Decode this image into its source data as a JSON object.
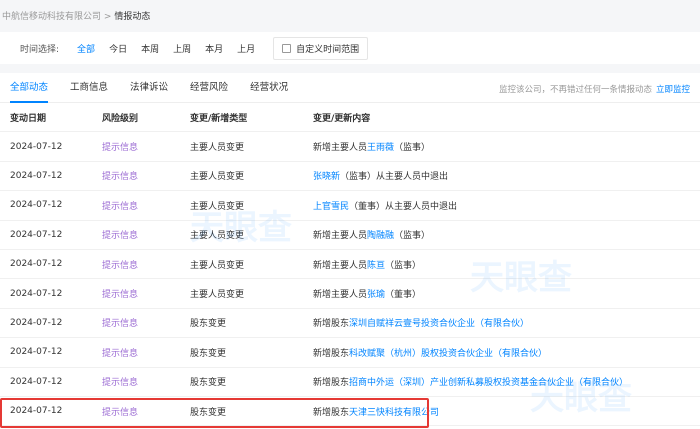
{
  "breadcrumb": {
    "company": "中航信移动科技有限公司",
    "sep": ">",
    "current": "情报动态"
  },
  "filter": {
    "label": "时间选择:",
    "options": [
      "全部",
      "今日",
      "本周",
      "上周",
      "本月",
      "上月"
    ],
    "custom": "自定义时间范围"
  },
  "tabs": [
    "全部动态",
    "工商信息",
    "法律诉讼",
    "经营风险",
    "经营状况"
  ],
  "monitor": {
    "text": "监控该公司，不再错过任何一条情报动态",
    "link": "立即监控"
  },
  "watermark": "天眼查",
  "columns": [
    "变动日期",
    "风险级别",
    "变更/新增类型",
    "变更/更新内容"
  ],
  "rows": [
    {
      "date": "2024-07-12",
      "risk": "提示信息",
      "type": "主要人员变更",
      "pre": "新增主要人员",
      "link": "王雨薇",
      "post": "（监事）"
    },
    {
      "date": "2024-07-12",
      "risk": "提示信息",
      "type": "主要人员变更",
      "pre": "",
      "link": "张晓新",
      "post": "（监事）从主要人员中退出"
    },
    {
      "date": "2024-07-12",
      "risk": "提示信息",
      "type": "主要人员变更",
      "pre": "",
      "link": "上官雪民",
      "post": "（董事）从主要人员中退出"
    },
    {
      "date": "2024-07-12",
      "risk": "提示信息",
      "type": "主要人员变更",
      "pre": "新增主要人员",
      "link": "陶融融",
      "post": "（监事）"
    },
    {
      "date": "2024-07-12",
      "risk": "提示信息",
      "type": "主要人员变更",
      "pre": "新增主要人员",
      "link": "陈亘",
      "post": "（监事）"
    },
    {
      "date": "2024-07-12",
      "risk": "提示信息",
      "type": "主要人员变更",
      "pre": "新增主要人员",
      "link": "张瑜",
      "post": "（董事）"
    },
    {
      "date": "2024-07-12",
      "risk": "提示信息",
      "type": "股东变更",
      "pre": "新增股东",
      "link": "深圳自赋祥云壹号投资合伙企业（有限合伙）",
      "post": ""
    },
    {
      "date": "2024-07-12",
      "risk": "提示信息",
      "type": "股东变更",
      "pre": "新增股东",
      "link": "科改赋聚（杭州）股权投资合伙企业（有限合伙）",
      "post": ""
    },
    {
      "date": "2024-07-12",
      "risk": "提示信息",
      "type": "股东变更",
      "pre": "新增股东",
      "link": "招商中外运（深圳）产业创新私募股权投资基金合伙企业（有限合伙）",
      "post": ""
    },
    {
      "date": "2024-07-12",
      "risk": "提示信息",
      "type": "股东变更",
      "pre": "新增股东",
      "link": "天津三快科技有限公司",
      "post": ""
    }
  ]
}
